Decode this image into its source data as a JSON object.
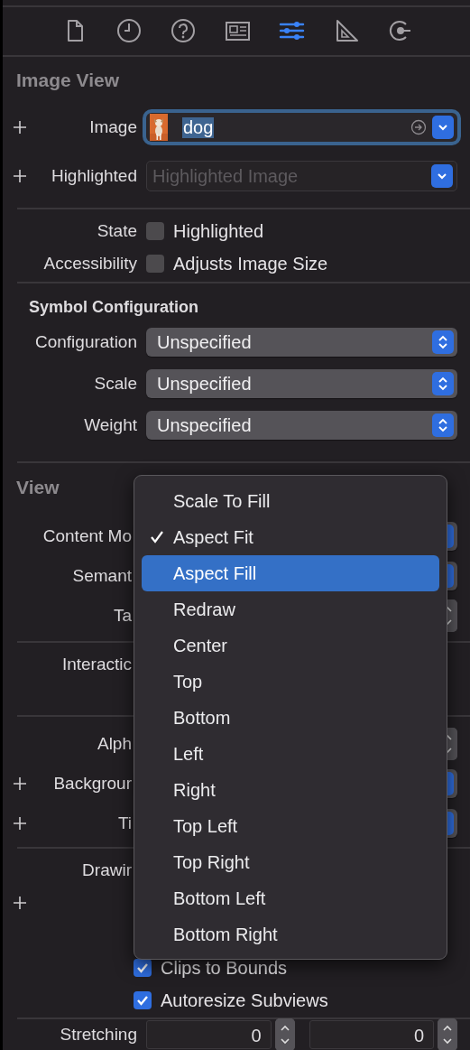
{
  "inspector_tabs": [
    {
      "selected": false
    },
    {
      "selected": false
    },
    {
      "selected": false
    },
    {
      "selected": false
    },
    {
      "selected": true
    },
    {
      "selected": false
    },
    {
      "selected": false
    }
  ],
  "sections": [
    {
      "title": "Image View",
      "rows": [
        {
          "kind": "image-field",
          "addable": true,
          "label": "Image",
          "value": "dog",
          "focused": true
        },
        {
          "kind": "combo",
          "addable": true,
          "label": "Highlighted",
          "placeholder": "Highlighted Image"
        }
      ]
    },
    {
      "rows": [
        {
          "kind": "checkbox",
          "addable": false,
          "label": "State",
          "text": "Highlighted",
          "checked": false
        },
        {
          "kind": "checkbox",
          "addable": false,
          "label": "Accessibility",
          "text": "Adjusts Image Size",
          "checked": false
        }
      ]
    },
    {
      "subtitle": "Symbol Configuration",
      "rows": [
        {
          "kind": "popup",
          "addable": false,
          "label": "Configuration",
          "value": "Unspecified"
        },
        {
          "kind": "popup",
          "addable": false,
          "label": "Scale",
          "value": "Unspecified"
        },
        {
          "kind": "popup",
          "addable": false,
          "label": "Weight",
          "value": "Unspecified"
        }
      ]
    },
    {
      "title": "View",
      "rows": [
        {
          "kind": "popup",
          "addable": false,
          "label": "Content Mo"
        },
        {
          "kind": "popup",
          "addable": false,
          "label": "Semant"
        },
        {
          "kind": "stepper",
          "addable": false,
          "label": "Ta"
        }
      ]
    },
    {
      "rows": [
        {
          "kind": "label",
          "addable": false,
          "label": "Interactic"
        }
      ]
    },
    {
      "rows": [
        {
          "kind": "stepper",
          "addable": false,
          "label": "Alph"
        },
        {
          "kind": "popup",
          "addable": true,
          "label": "Backgrour"
        },
        {
          "kind": "popup",
          "addable": true,
          "label": "Ti"
        }
      ]
    },
    {
      "rows": [
        {
          "kind": "label",
          "addable": false,
          "label": "Drawir"
        },
        {
          "kind": "plus",
          "addable": true
        },
        {
          "kind": "checkbox",
          "addable": false,
          "text": "Clips to Bounds",
          "checked": true
        },
        {
          "kind": "checkbox",
          "addable": false,
          "text": "Autoresize Subviews",
          "checked": true
        }
      ]
    },
    {
      "rows": [
        {
          "kind": "number-pair",
          "addable": false,
          "label": "Stretching",
          "values": [
            "0",
            "0"
          ]
        }
      ]
    }
  ],
  "menu": {
    "items": [
      {
        "label": "Scale To Fill",
        "checked": false,
        "highlighted": false
      },
      {
        "label": "Aspect Fit",
        "checked": true,
        "highlighted": false
      },
      {
        "label": "Aspect Fill",
        "checked": false,
        "highlighted": true
      },
      {
        "label": "Redraw",
        "checked": false,
        "highlighted": false
      },
      {
        "label": "Center",
        "checked": false,
        "highlighted": false
      },
      {
        "label": "Top",
        "checked": false,
        "highlighted": false
      },
      {
        "label": "Bottom",
        "checked": false,
        "highlighted": false
      },
      {
        "label": "Left",
        "checked": false,
        "highlighted": false
      },
      {
        "label": "Right",
        "checked": false,
        "highlighted": false
      },
      {
        "label": "Top Left",
        "checked": false,
        "highlighted": false
      },
      {
        "label": "Top Right",
        "checked": false,
        "highlighted": false
      },
      {
        "label": "Bottom Left",
        "checked": false,
        "highlighted": false
      },
      {
        "label": "Bottom Right",
        "checked": false,
        "highlighted": false
      }
    ]
  }
}
